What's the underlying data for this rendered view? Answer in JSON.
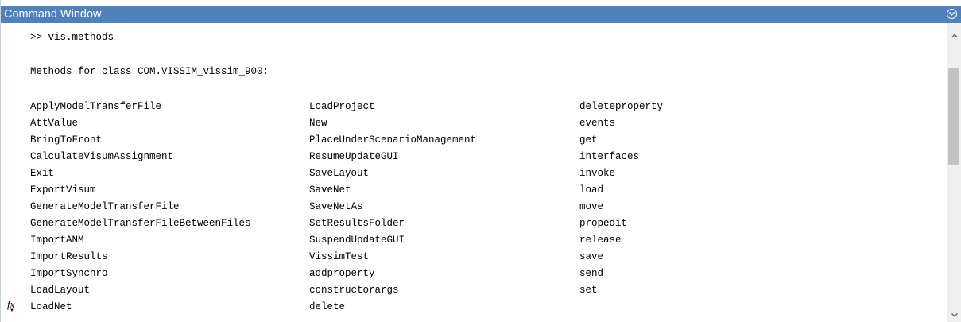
{
  "window": {
    "title": "Command Window"
  },
  "console": {
    "prompt_line": ">> vis.methods",
    "class_line": "Methods for class COM.VISSIM_vissim_900:",
    "columns": [
      [
        "ApplyModelTransferFile",
        "AttValue",
        "BringToFront",
        "CalculateVisumAssignment",
        "Exit",
        "ExportVisum",
        "GenerateModelTransferFile",
        "GenerateModelTransferFileBetweenFiles",
        "ImportANM",
        "ImportResults",
        "ImportSynchro",
        "LoadLayout",
        "LoadNet"
      ],
      [
        "LoadProject",
        "New",
        "PlaceUnderScenarioManagement",
        "ResumeUpdateGUI",
        "SaveLayout",
        "SaveNet",
        "SaveNetAs",
        "SetResultsFolder",
        "SuspendUpdateGUI",
        "VissimTest",
        "addproperty",
        "constructorargs",
        "delete"
      ],
      [
        "deleteproperty",
        "events",
        "get",
        "interfaces",
        "invoke",
        "load",
        "move",
        "propedit",
        "release",
        "save",
        "send",
        "set"
      ]
    ],
    "fx_label": "fx"
  },
  "colors": {
    "titlebar_bg": "#4f81bd",
    "titlebar_text": "#ffffff",
    "console_text": "#000000",
    "scrollbar_track": "#f0f0f0",
    "scrollbar_thumb": "#c2c2c2"
  },
  "icons": {
    "title_menu": "chevron-down-circle-icon",
    "function_browser": "fx-icon",
    "scroll_up": "chevron-up-icon",
    "scroll_down": "chevron-down-icon"
  }
}
